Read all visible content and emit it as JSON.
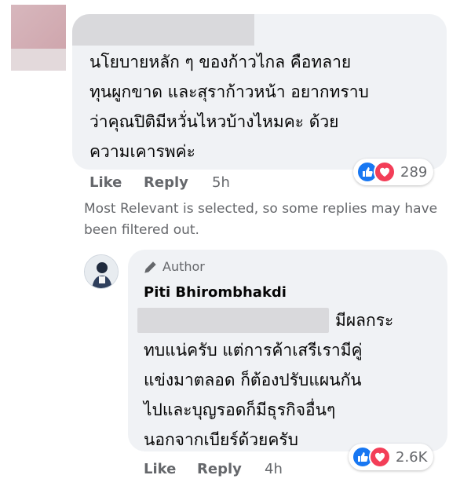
{
  "comment1": {
    "text_lines": [
      "นโยบายหลัก ๆ ของก้าวไกล คือทลาย",
      "ทุนผูกขาด และสุราก้าวหน้า อยากทราบ",
      "ว่าคุณปิติมีหวั่นไหวบ้างไหมคะ ด้วย",
      "ความเคารพค่ะ"
    ],
    "reactions": {
      "icons": [
        "like-icon",
        "love-icon"
      ],
      "count": "289"
    },
    "actions": {
      "like": "Like",
      "reply": "Reply",
      "time": "5h"
    }
  },
  "filter_notice": {
    "lines": [
      "Most Relevant is selected, so some replies may have",
      "been filtered out."
    ]
  },
  "reply1": {
    "badge": "Author",
    "author": "Piti Bhirombhakdi",
    "text_lines": [
      "มีผลกระ",
      "ทบแน่ครับ แต่การค้าเสรีเรามีคู่",
      "แข่งมาตลอด ก็ต้องปรับแผนกัน",
      "ไปและบุญรอดก็มีธุรกิจอื่นๆ",
      "นอกจากเบียร์ด้วยครับ"
    ],
    "reactions": {
      "icons": [
        "like-icon",
        "love-icon"
      ],
      "count": "2.6K"
    },
    "actions": {
      "like": "Like",
      "reply": "Reply",
      "time": "4h"
    }
  }
}
